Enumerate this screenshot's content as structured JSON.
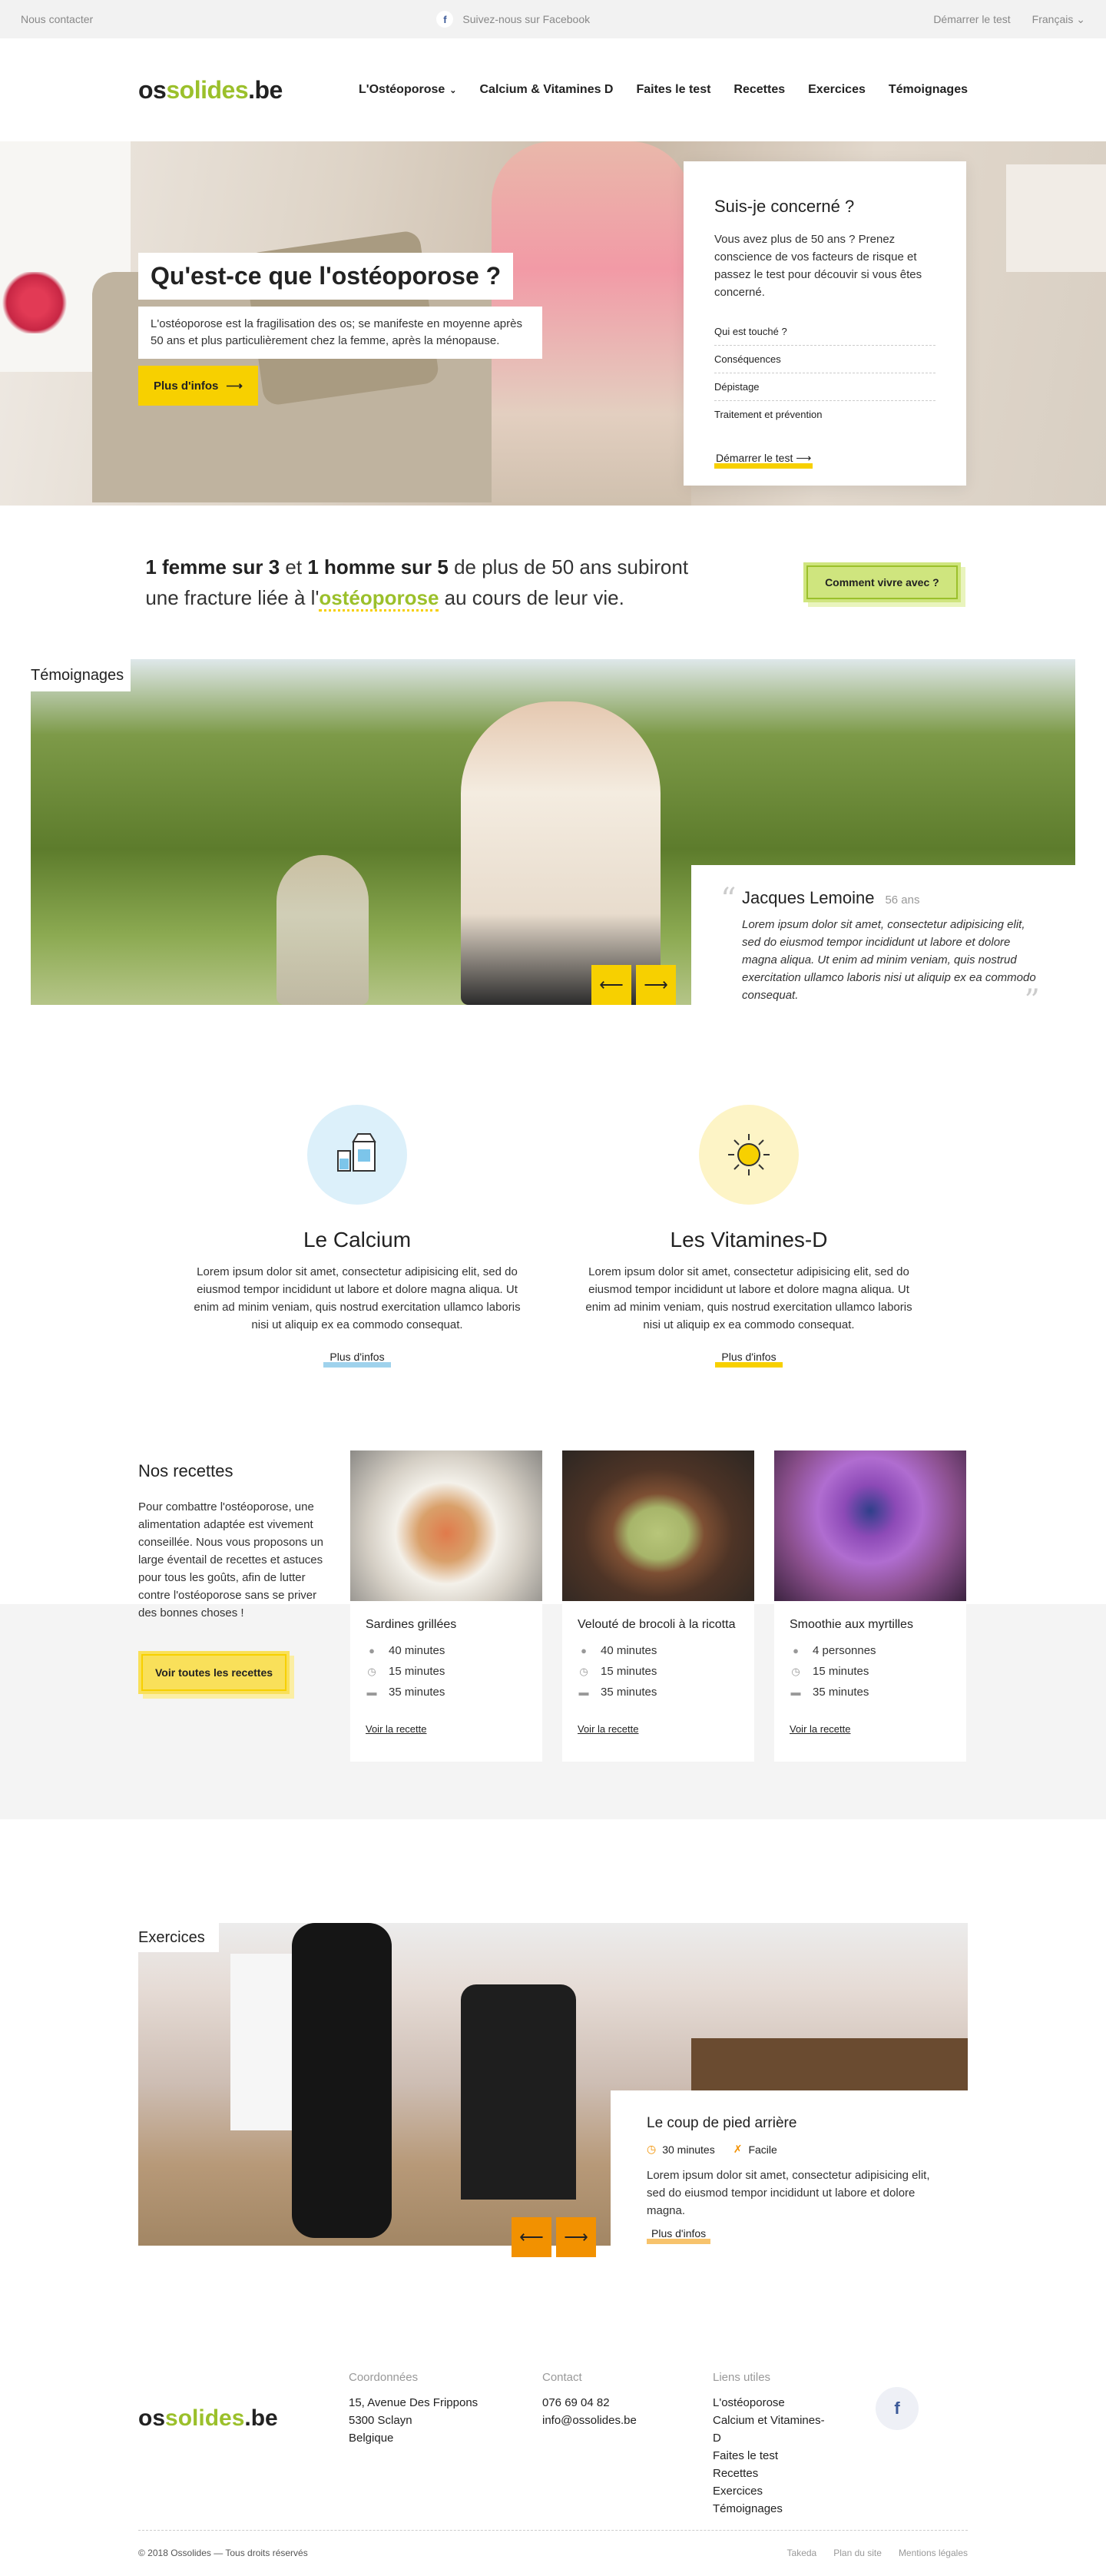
{
  "topbar": {
    "contact": "Nous contacter",
    "facebook": "Suivez-nous sur Facebook",
    "start_test": "Démarrer le test",
    "language": "Français"
  },
  "header": {
    "logo_a": "os",
    "logo_b": "solides",
    "logo_c": ".be",
    "nav": [
      "L'Ostéoporose",
      "Calcium & Vitamines D",
      "Faites le test",
      "Recettes",
      "Exercices",
      "Témoignages"
    ]
  },
  "hero": {
    "title": "Qu'est-ce que l'ostéoporose ?",
    "description": "L'ostéoporose est la fragilisation des os; se manifeste en moyenne après 50 ans et plus particulièrement chez la femme, après la ménopause.",
    "button": "Plus d'infos",
    "card": {
      "title": "Suis-je concerné ?",
      "text": "Vous avez plus de 50 ans ? Prenez conscience de vos facteurs de risque et passez le test pour découvir si vous êtes concerné.",
      "items": [
        "Qui est touché ?",
        "Conséquences",
        "Dépistage",
        "Traitement et prévention"
      ],
      "link": "Démarrer le test"
    }
  },
  "stat": {
    "part1_bold": "1 femme sur 3",
    "part1_mid": " et ",
    "part1_bold2": "1 homme sur 5",
    "part1_end": " de plus de 50 ans subiront",
    "part2_start": "une fracture liée à l'",
    "part2_hl": "ostéoporose",
    "part2_end": " au cours de leur vie.",
    "button": "Comment vivre avec ?"
  },
  "testimonials": {
    "label": "Témoignages",
    "name": "Jacques Lemoine",
    "age": "56 ans",
    "quote": "Lorem ipsum dolor sit amet, consectetur adipisicing elit, sed do eiusmod tempor incididunt ut labore et dolore magna aliqua. Ut enim ad minim veniam, quis nostrud exercitation ullamco laboris nisi ut aliquip ex ea commodo consequat."
  },
  "calcium": {
    "title": "Le Calcium",
    "text": "Lorem ipsum dolor sit amet, consectetur adipisicing elit, sed do eiusmod tempor incididunt ut labore et dolore magna aliqua. Ut enim ad minim veniam, quis nostrud exercitation ullamco laboris nisi ut aliquip ex ea commodo consequat.",
    "link": "Plus d'infos",
    "accent": "#9fd2ec"
  },
  "vitamins": {
    "title": "Les Vitamines-D",
    "text": "Lorem ipsum dolor sit amet, consectetur adipisicing elit, sed do eiusmod tempor incididunt ut labore et dolore magna aliqua. Ut enim ad minim veniam, quis nostrud exercitation ullamco laboris nisi ut aliquip ex ea commodo consequat.",
    "link": "Plus d'infos",
    "accent": "#f7d000"
  },
  "recipes": {
    "title": "Nos recettes",
    "text": "Pour combattre l'ostéoporose, une alimentation adaptée est vivement conseillée. Nous vous proposons un large éventail de recettes et astuces pour tous les goûts, afin de lutter contre l'ostéoporose sans se priver des bonnes choses !",
    "button": "Voir toutes les recettes",
    "cards": [
      {
        "title": "Sardines grillées",
        "m1": "40 minutes",
        "m2": "15 minutes",
        "m3": "35 minutes",
        "link": "Voir la recette"
      },
      {
        "title": "Velouté de brocoli à la ricotta",
        "m1": "40 minutes",
        "m2": "15 minutes",
        "m3": "35 minutes",
        "link": "Voir la recette"
      },
      {
        "title": "Smoothie aux myrtilles",
        "m1": "4 personnes",
        "m2": "15 minutes",
        "m3": "35 minutes",
        "link": "Voir la recette"
      }
    ]
  },
  "exercises": {
    "label": "Exercices",
    "title": "Le coup de pied arrière",
    "duration": "30 minutes",
    "level": "Facile",
    "text": "Lorem ipsum dolor sit amet, consectetur adipisicing elit, sed do eiusmod tempor incididunt ut labore et dolore magna.",
    "link": "Plus d'infos"
  },
  "footer": {
    "coords_h": "Coordonnées",
    "coords": [
      "15, Avenue Des Frippons",
      "5300 Sclayn",
      "Belgique"
    ],
    "contact_h": "Contact",
    "contact": [
      "076 69 04 82",
      "info@ossolides.be"
    ],
    "links_h": "Liens utiles",
    "links": [
      "L'ostéoporose",
      "Calcium et Vitamines-D",
      "Faites le test",
      "Recettes",
      "Exercices",
      "Témoignages"
    ],
    "copyright": "© 2018 Ossolides — Tous droits réservés",
    "bottom_links": [
      "Takeda",
      "Plan du site",
      "Mentions légales"
    ]
  },
  "colors": {
    "green": "#9bc02b",
    "yellow": "#f7d000",
    "orange": "#f29100"
  }
}
